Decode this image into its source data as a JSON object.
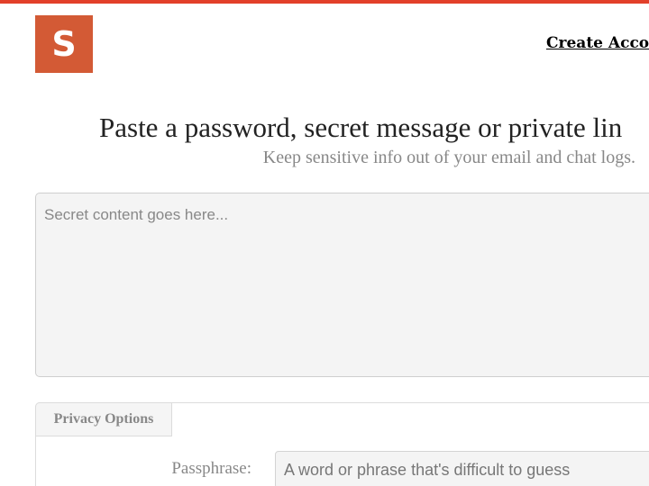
{
  "brand": {
    "logo_letter": "S",
    "accent_color": "#e2402a",
    "logo_color": "#d35a35"
  },
  "header": {
    "create_account": "Create Acco"
  },
  "hero": {
    "headline": "Paste a password, secret message or private lin",
    "subheadline": "Keep sensitive info out of your email and chat logs."
  },
  "secret_field": {
    "placeholder": "Secret content goes here...",
    "value": ""
  },
  "privacy_options": {
    "tab_label": "Privacy Options",
    "passphrase_label": "Passphrase:",
    "passphrase_placeholder": "A word or phrase that's difficult to guess",
    "passphrase_value": ""
  }
}
